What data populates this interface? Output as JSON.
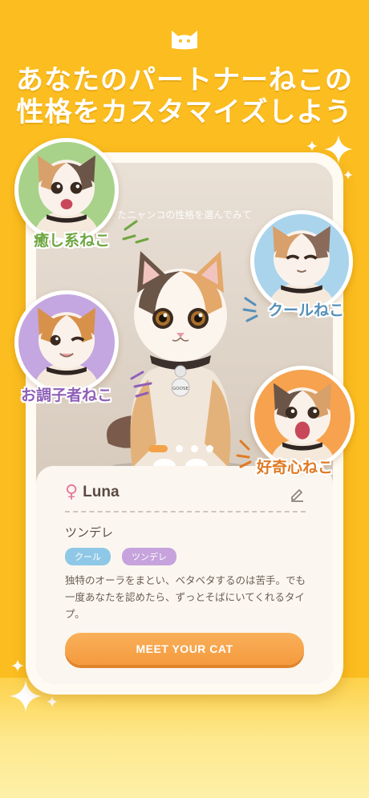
{
  "headline": {
    "line1": "あなたのパートナーねこの",
    "line2": "性格をカスタマイズしよう"
  },
  "screen": {
    "hint": "たニャンコの性格を選んでみて",
    "carousel": {
      "total": 4,
      "active_index": 0
    }
  },
  "personalities": [
    {
      "label": "癒し系ねこ",
      "color": "#a8d28a"
    },
    {
      "label": "クールねこ",
      "color": "#a9d4ec"
    },
    {
      "label": "お調子者ねこ",
      "color": "#c4a6e0"
    },
    {
      "label": "好奇心ねこ",
      "color": "#f6a24e"
    }
  ],
  "profile": {
    "name": "Luna",
    "gender_symbol": "♀",
    "personality": "ツンデレ",
    "tags": [
      "クール",
      "ツンデレ"
    ],
    "description": "独特のオーラをまとい、ベタベタするのは苦手。でも一度あなたを認めたら、ずっとそばにいてくれるタイプ。",
    "cta_label": "MEET YOUR CAT"
  },
  "collar_tag_text": "GOOSE",
  "colors": {
    "background": "#fbbd1f",
    "accent": "#f59a3e",
    "female": "#e7799a"
  }
}
